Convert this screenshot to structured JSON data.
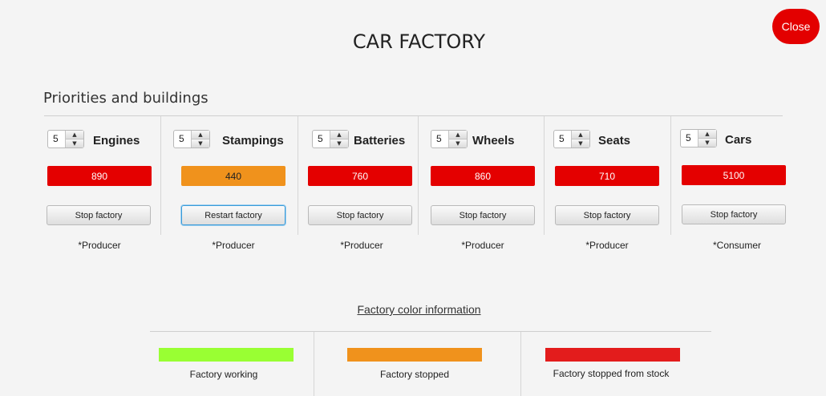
{
  "header": {
    "title": "CAR FACTORY",
    "close_label": "Close"
  },
  "section": {
    "title": "Priorities and buildings"
  },
  "buildings": [
    {
      "name": "Engines",
      "priority": "5",
      "stock": "890",
      "stock_color": "#e40000",
      "button_label": "Stop factory",
      "role": "*Producer"
    },
    {
      "name": "Stampings",
      "priority": "5",
      "stock": "440",
      "stock_color": "#f0921c",
      "button_label": "Restart factory",
      "role": "*Producer"
    },
    {
      "name": "Batteries",
      "priority": "5",
      "stock": "760",
      "stock_color": "#e40000",
      "button_label": "Stop factory",
      "role": "*Producer"
    },
    {
      "name": "Wheels",
      "priority": "5",
      "stock": "860",
      "stock_color": "#e40000",
      "button_label": "Stop factory",
      "role": "*Producer"
    },
    {
      "name": "Seats",
      "priority": "5",
      "stock": "710",
      "stock_color": "#e40000",
      "button_label": "Stop factory",
      "role": "*Producer"
    },
    {
      "name": "Cars",
      "priority": "5",
      "stock": "5100",
      "stock_color": "#e40000",
      "button_label": "Stop factory",
      "role": "*Consumer"
    }
  ],
  "legend": {
    "title": "Factory color information",
    "items": [
      {
        "label": "Factory working",
        "color": "#99ff33"
      },
      {
        "label": "Factory stopped",
        "color": "#f0921c"
      },
      {
        "label": "Factory stopped from stock",
        "color": "#e31c1c"
      }
    ]
  }
}
